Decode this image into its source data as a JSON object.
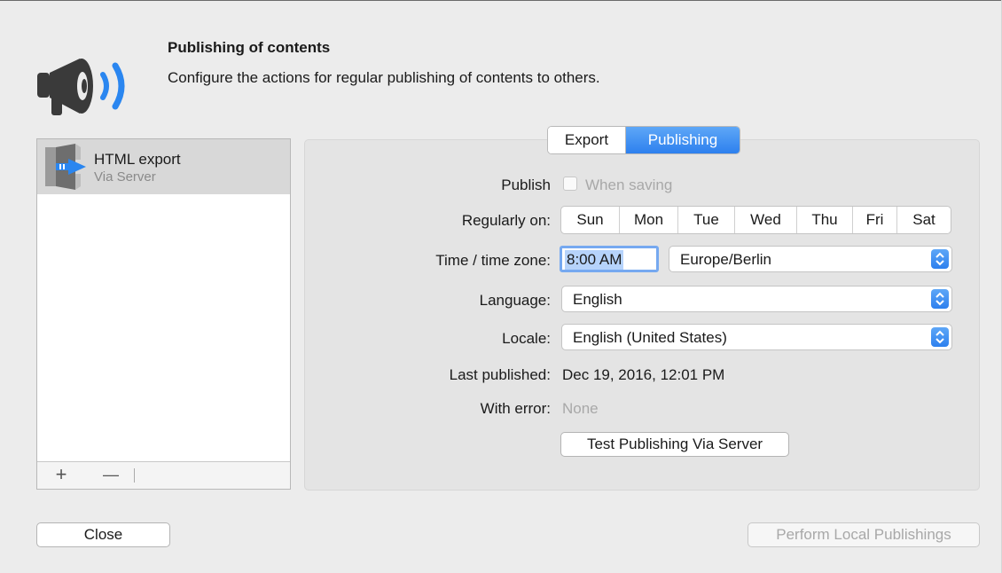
{
  "header": {
    "title": "Publishing of contents",
    "description": "Configure the actions for regular publishing of contents to others."
  },
  "list": {
    "items": [
      {
        "title": "HTML export",
        "subtitle": "Via Server"
      }
    ],
    "add_label": "+",
    "remove_label": "—"
  },
  "tabs": {
    "export": "Export",
    "publishing": "Publishing",
    "selected": "Publishing"
  },
  "form": {
    "publish_label": "Publish",
    "when_saving_label": "When saving",
    "when_saving_checked": false,
    "regularly_label": "Regularly on:",
    "days": [
      "Sun",
      "Mon",
      "Tue",
      "Wed",
      "Thu",
      "Fri",
      "Sat"
    ],
    "time_label": "Time / time zone:",
    "time_value": "8:00 AM",
    "timezone_value": "Europe/Berlin",
    "language_label": "Language:",
    "language_value": "English",
    "locale_label": "Locale:",
    "locale_value": "English (United States)",
    "last_published_label": "Last published:",
    "last_published_value": "Dec 19, 2016, 12:01 PM",
    "with_error_label": "With error:",
    "with_error_value": "None",
    "test_button": "Test Publishing Via Server"
  },
  "footer": {
    "close_button": "Close",
    "perform_button": "Perform Local Publishings"
  },
  "colors": {
    "accent": "#2d80ee",
    "background": "#ececec",
    "selection": "#d8d8d8"
  }
}
